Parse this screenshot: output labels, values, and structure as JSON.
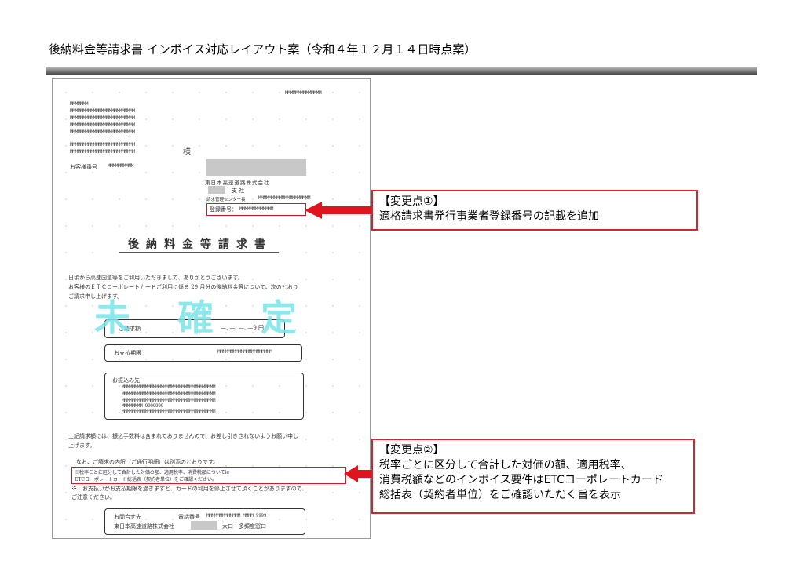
{
  "slide": {
    "title": "後納料金等請求書 インボイス対応レイアウト案（令和４年１２月１４日時点案）"
  },
  "document": {
    "top_code": "MMMMMMMMMMMMMM",
    "address_lines": [
      "MMMMMMM",
      "MMMMMMMMMMMMMMMMMMMMMMMMM",
      "MMMMMMMMMMMMMMMMMMMMMMMMM",
      "MMMMMMMMMMMMMMMMMMMMMMMMM",
      "MMMMMMMMMMMMMMMMMMMMMMMMM"
    ],
    "name_lines": [
      "MMMMMMMMMMMMMMMMMMMMMMMMM",
      "MMMMMMMMMMMMMMMMMMMMMMMMM"
    ],
    "honorific": "様",
    "customer_no_label": "お客様番号",
    "customer_no_value": "MMMMMMMMMM",
    "company_name": "東日本高速道路株式会社",
    "branch_label": "支 社",
    "center_label": "請求管理センター長",
    "center_value": "MMMMMMMMMMMMMMMMMMMM",
    "registration_label": "登録番号：",
    "registration_value": "MMMMMMMMMMMMM",
    "doc_title": "後納料金等請求書",
    "greeting": [
      "日頃から高速国道等をご利用いただきまして、ありがとうございます。",
      "お客様のＥＴＣコーポレートカードご利用に係る 29 月分の後納料金等について、次のとおり",
      "ご請求申し上げます。"
    ],
    "watermark": "未確定",
    "billing_amount_label": "ご請求額",
    "billing_amount_value": "—, —, —, —9 円",
    "due_date_label": "お支払期限",
    "due_date_value": "MMMMMMMMMMMMMMMMMMMMM",
    "transfer_label": "お振込み先",
    "transfer_lines": [
      "MMMMMMMMMMMMMMMMMMMMMMMMMMMMMMMMMMMM",
      "MMMMMMMMMMMMMMMMMMMMMMMMMMMMMMMMMMMM",
      "MMMMMMMMMMMMMMMMMMMMMMMMMMMMMMMMMMMM",
      "MMMMMMMM  9999999",
      "MMMMMMMMMMMMMMMMMMMMMMMMMMMMMMMMMMMM"
    ],
    "note_fee": [
      "上記請求額には、振込手数料は含まれておりませんので、お差し引きされないようお願い申し",
      "上げます。"
    ],
    "note_detail": "なお、ご請求の内訳（ご通行明細）は別添のとおりです。",
    "note_tax": [
      "※税率ごとに区分して合計した対価の額、適用税率、消費税額については",
      "ETCコーポレートカード総括表（契約者単位）をご確認ください。"
    ],
    "note_payment": [
      "※　お支払いがお支払期限を過ぎますと、カードの利用を停止させて頂くことがありますので、",
      "ご注意ください。"
    ],
    "contact_label": "お問合せ先",
    "phone_label": "電話番号",
    "phone_value": "MMMMMMMMMMMMM  MMMM  9999",
    "contact_company": "東日本高速道路株式会社",
    "contact_desk": "大口・多頻度窓口"
  },
  "callouts": [
    {
      "heading": "【変更点①】",
      "lines": [
        "適格請求書発行事業者登録番号の記載を追加"
      ]
    },
    {
      "heading": "【変更点②】",
      "lines": [
        "税率ごとに区分して合計した対価の額、適用税率、",
        "消費税額などのインボイス要件はETCコーポレートカード",
        "総括表（契約者単位）をご確認いただく旨を表示"
      ]
    }
  ],
  "colors": {
    "accent_red": "#d7232c",
    "watermark_cyan": "#79e4e8"
  }
}
